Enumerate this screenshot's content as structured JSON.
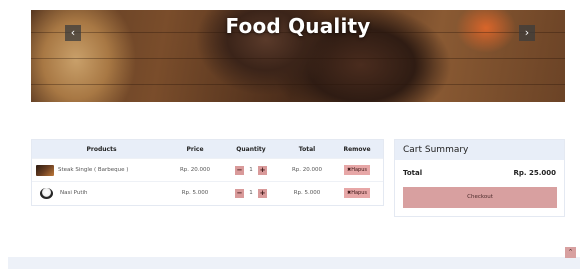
{
  "hero": {
    "title": "Food Quality",
    "prev_glyph": "‹",
    "next_glyph": "›"
  },
  "table": {
    "headers": {
      "products": "Products",
      "price": "Price",
      "quantity": "Quantity",
      "total": "Total",
      "remove": "Remove"
    },
    "rows": [
      {
        "name": "Steak Single ( Barbeque )",
        "price": "Rp. 20.000",
        "qty_minus": "−",
        "qty": "1",
        "qty_plus": "+",
        "total": "Rp. 20.000",
        "remove": "✖Hapus",
        "thumb_icon": "steak-image"
      },
      {
        "name": "Nasi Putih",
        "price": "Rp. 5.000",
        "qty_minus": "−",
        "qty": "1",
        "qty_plus": "+",
        "total": "Rp. 5.000",
        "remove": "✖Hapus",
        "thumb_icon": "rice-bowl-image"
      }
    ]
  },
  "summary": {
    "title": "Cart Summary",
    "total_label": "Total",
    "total_value": "Rp. 25.000",
    "checkout_label": "Checkout"
  },
  "scroll_top": {
    "glyph": "⌃"
  },
  "colors": {
    "accent": "#d8a0a0",
    "header_bg": "#e8eef8"
  }
}
